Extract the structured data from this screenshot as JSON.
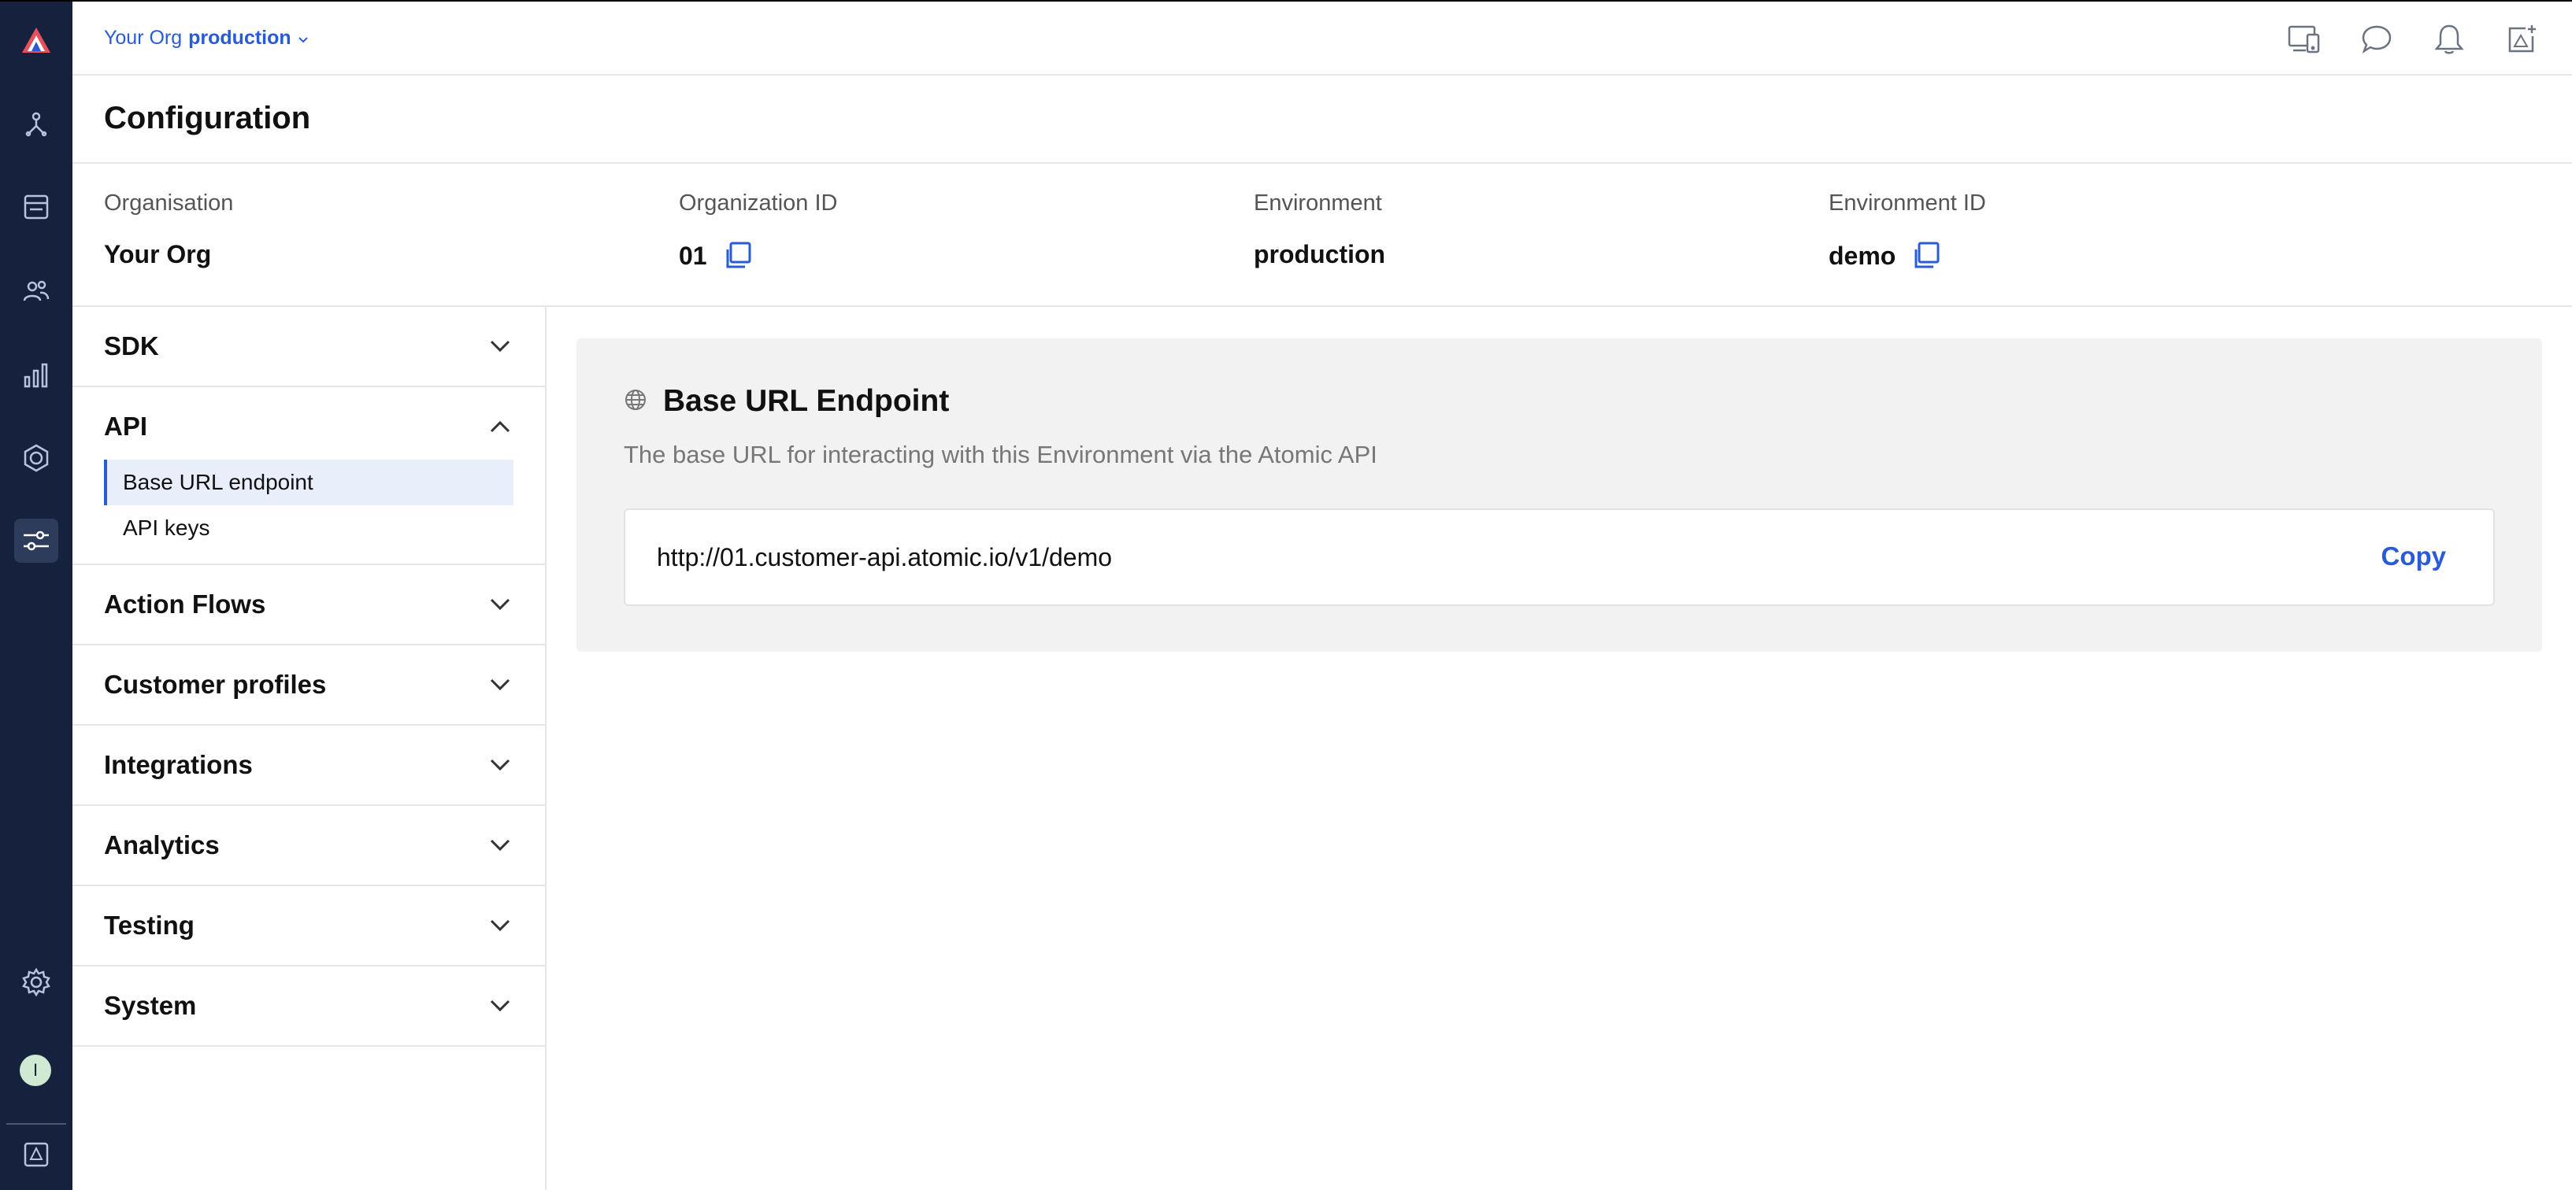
{
  "topbar": {
    "org_name": "Your Org",
    "environment": "production"
  },
  "page": {
    "title": "Configuration"
  },
  "info": {
    "organisation_label": "Organisation",
    "organisation_value": "Your Org",
    "org_id_label": "Organization ID",
    "org_id_value": "01",
    "environment_label": "Environment",
    "environment_value": "production",
    "env_id_label": "Environment ID",
    "env_id_value": "demo"
  },
  "sidebar": {
    "sections": [
      {
        "title": "SDK",
        "expanded": false
      },
      {
        "title": "API",
        "expanded": true,
        "items": [
          {
            "label": "Base URL endpoint",
            "active": true
          },
          {
            "label": "API keys",
            "active": false
          }
        ]
      },
      {
        "title": "Action Flows",
        "expanded": false
      },
      {
        "title": "Customer profiles",
        "expanded": false
      },
      {
        "title": "Integrations",
        "expanded": false
      },
      {
        "title": "Analytics",
        "expanded": false
      },
      {
        "title": "Testing",
        "expanded": false
      },
      {
        "title": "System",
        "expanded": false
      }
    ]
  },
  "main": {
    "card_title": "Base URL Endpoint",
    "card_description": "The base URL for interacting with this Environment via the Atomic API",
    "url": "http://01.customer-api.atomic.io/v1/demo",
    "copy_label": "Copy"
  },
  "user": {
    "avatar_initial": "I"
  },
  "icons": {
    "rail": [
      "atomic-logo-icon",
      "flows-icon",
      "cards-icon",
      "users-icon",
      "analytics-icon",
      "integrations-icon",
      "configuration-icon",
      "settings-icon",
      "workbench-icon"
    ],
    "top": [
      "device-preview-icon",
      "chat-icon",
      "notifications-icon",
      "new-card-icon"
    ]
  },
  "colors": {
    "rail_bg": "#16213e",
    "accent": "#2a5bd7",
    "active_item_bg": "#e8effb",
    "card_bg": "#f2f2f2"
  }
}
